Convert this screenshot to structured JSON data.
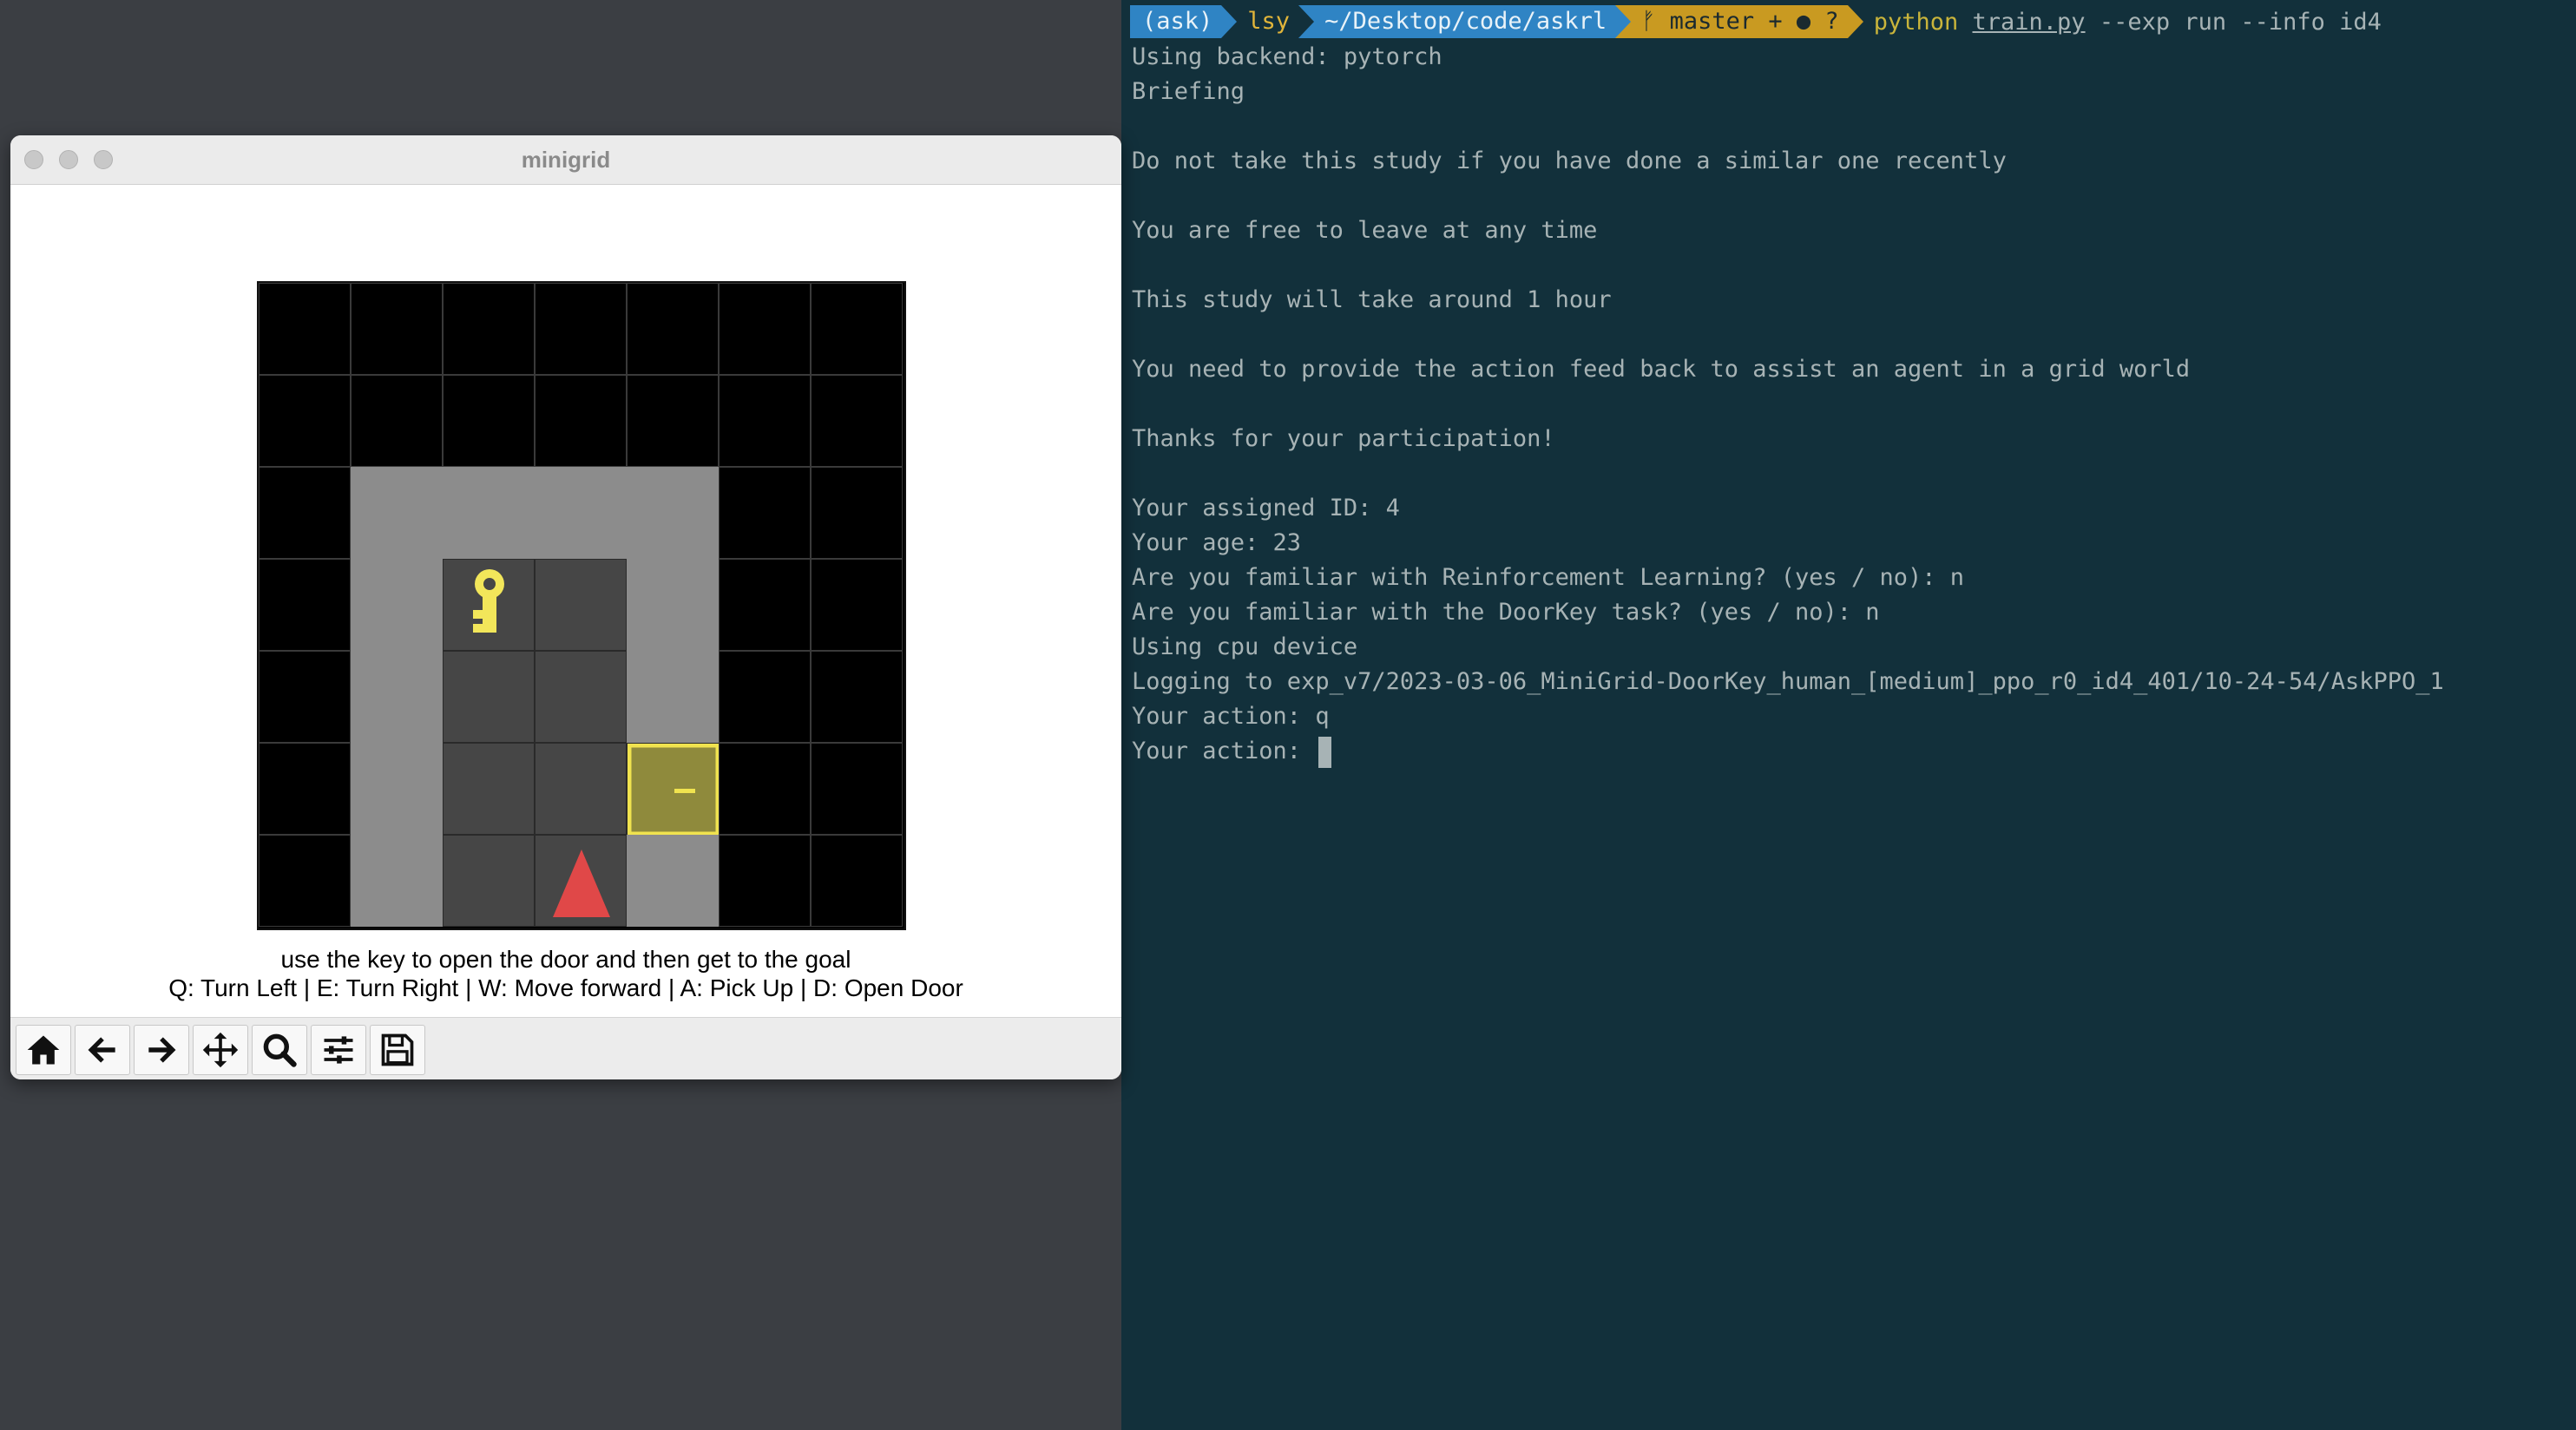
{
  "terminal": {
    "prompt": {
      "env": "(ask)",
      "user": "lsy",
      "dir": "~/Desktop/code/askrl",
      "git": "ᚠ master + ● ?",
      "cmd_python": "python",
      "cmd_file": "train.py",
      "cmd_args": "--exp run --info id4"
    },
    "lines": [
      "Using backend: pytorch",
      "Briefing",
      "",
      "Do not take this study if you have done a similar one recently",
      "",
      "You are free to leave at any time",
      "",
      "This study will take around 1 hour",
      "",
      "You need to provide the action feed back to assist an agent in a grid world",
      "",
      "Thanks for your participation!",
      "",
      "Your assigned ID: 4",
      "Your age: 23",
      "Are you familiar with Reinforcement Learning? (yes / no): n",
      "Are you familiar with the DoorKey task? (yes / no): n",
      "Using cpu device",
      "Logging to exp_v7/2023-03-06_MiniGrid-DoorKey_human_[medium]_ppo_r0_id4_401/10-24-54/AskPPO_1",
      "Your action: q",
      "Your action: "
    ]
  },
  "minigrid": {
    "title": "minigrid",
    "mission": "use the key to open the door and then get to the goal",
    "controls": "Q: Turn Left | E: Turn Right | W: Move forward | A: Pick Up | D: Open Door",
    "toolbar": [
      {
        "name": "home-icon",
        "icon": "home"
      },
      {
        "name": "back-icon",
        "icon": "arrow-left"
      },
      {
        "name": "forward-icon",
        "icon": "arrow-right"
      },
      {
        "name": "pan-icon",
        "icon": "move"
      },
      {
        "name": "zoom-icon",
        "icon": "search"
      },
      {
        "name": "configure-subplots-icon",
        "icon": "sliders"
      },
      {
        "name": "save-icon",
        "icon": "floppy"
      }
    ],
    "grid": {
      "cols": 7,
      "rows": 7,
      "cells": [
        [
          "black",
          "black",
          "black",
          "black",
          "black",
          "black",
          "black"
        ],
        [
          "black",
          "black",
          "black",
          "black",
          "black",
          "black",
          "black"
        ],
        [
          "black",
          "gray",
          "gray",
          "gray",
          "gray",
          "black",
          "black"
        ],
        [
          "black",
          "gray",
          "key",
          "dark",
          "gray",
          "black",
          "black"
        ],
        [
          "black",
          "gray",
          "dark",
          "dark",
          "gray",
          "black",
          "black"
        ],
        [
          "black",
          "gray",
          "dark",
          "dark",
          "door",
          "black",
          "black"
        ],
        [
          "black",
          "gray",
          "dark",
          "agent",
          "gray",
          "black",
          "black"
        ]
      ],
      "colors": {
        "black": "#000000",
        "gray": "#8c8c8c",
        "dark": "#464646",
        "key": "#f2e65a",
        "door": "#f0e34f",
        "agent": "#e04848"
      }
    }
  }
}
